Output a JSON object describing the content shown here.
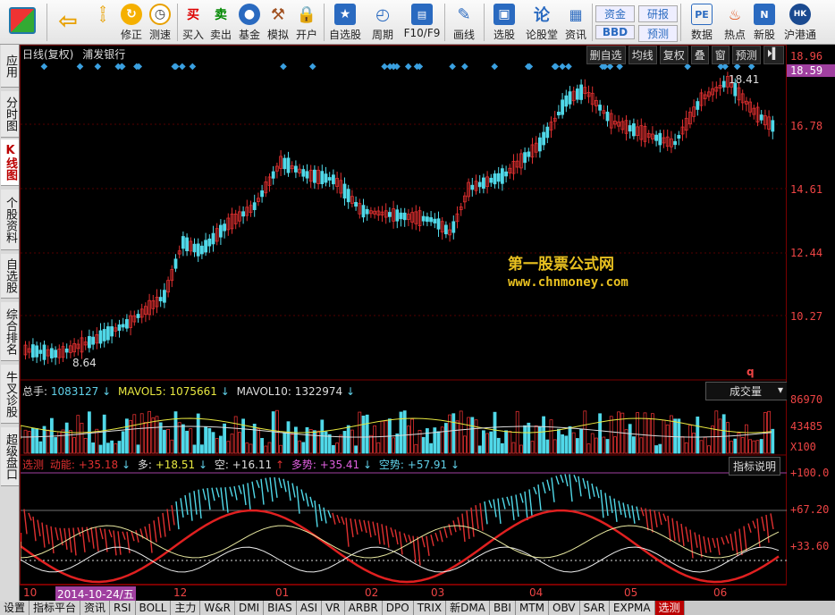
{
  "toolbar": {
    "buttons": [
      {
        "label": "修正"
      },
      {
        "label": "测速"
      },
      {
        "label": "买入"
      },
      {
        "label": "卖出"
      },
      {
        "label": "基金"
      },
      {
        "label": "模拟"
      },
      {
        "label": "开户"
      },
      {
        "label": "自选股"
      },
      {
        "label": "周期"
      },
      {
        "label": "F10/F9"
      },
      {
        "label": "画线"
      },
      {
        "label": "选股"
      },
      {
        "label": "论股堂"
      },
      {
        "label": "资讯"
      },
      {
        "label": "数据"
      },
      {
        "label": "热点"
      },
      {
        "label": "新股"
      },
      {
        "label": "沪港通"
      }
    ],
    "money_btn": "资金",
    "bbd_btn": "BBD",
    "research_btn": "研报",
    "forecast_btn": "预测",
    "buy_icon": "买",
    "sell_icon": "卖"
  },
  "sidebar": {
    "tabs": [
      "应用",
      "分时图",
      "K线图",
      "个股资料",
      "自选股",
      "综合排名",
      "牛叉诊股",
      "超级盘口"
    ]
  },
  "chart": {
    "title": "日线(复权)",
    "stock": "浦发银行",
    "top_buttons": [
      "删自选",
      "均线",
      "复权",
      "叠",
      "窗",
      "预测"
    ],
    "price_axis": [
      "18.96",
      "18.59",
      "16.78",
      "14.61",
      "12.44",
      "10.27"
    ],
    "high_label": "18.41",
    "low_label": "8.64",
    "watermark_cn": "第一股票公式网",
    "watermark_url": "www.chnmoney.com",
    "q_mark": "q"
  },
  "volume": {
    "label_total": "总手:",
    "total": "1083127",
    "label_mavol5": "MAVOL5:",
    "mavol5": "1075661",
    "label_mavol10": "MAVOL10:",
    "mavol10": "1322974",
    "dropdown": "成交量",
    "axis": [
      "86970",
      "43485",
      "X100"
    ]
  },
  "indicator": {
    "name": "选测",
    "dongneng_label": "动能:",
    "dongneng": "+35.18",
    "duo_label": "多:",
    "duo": "+18.51",
    "kong_label": "空:",
    "kong": "+16.11",
    "duoshi_label": "多势:",
    "duoshi": "+35.41",
    "kongshi_label": "空势:",
    "kongshi": "+57.91",
    "help_btn": "指标说明",
    "axis": [
      "+100.0",
      "+67.20",
      "+33.60"
    ]
  },
  "dates": {
    "labels": [
      "10",
      "12",
      "01",
      "02",
      "03",
      "04",
      "05",
      "06"
    ],
    "highlight": "2014-10-24/五"
  },
  "bottom_tabs": [
    "设置",
    "指标平台",
    "资讯",
    "RSI",
    "BOLL",
    "主力",
    "W&R",
    "DMI",
    "BIAS",
    "ASI",
    "VR",
    "ARBR",
    "DPO",
    "TRIX",
    "新DMA",
    "BBI",
    "MTM",
    "OBV",
    "SAR",
    "EXPMA",
    "选测"
  ],
  "colors": {
    "up": "#e03030",
    "down": "#50d8e8",
    "axis": "#e44",
    "accent": "#b00000"
  }
}
